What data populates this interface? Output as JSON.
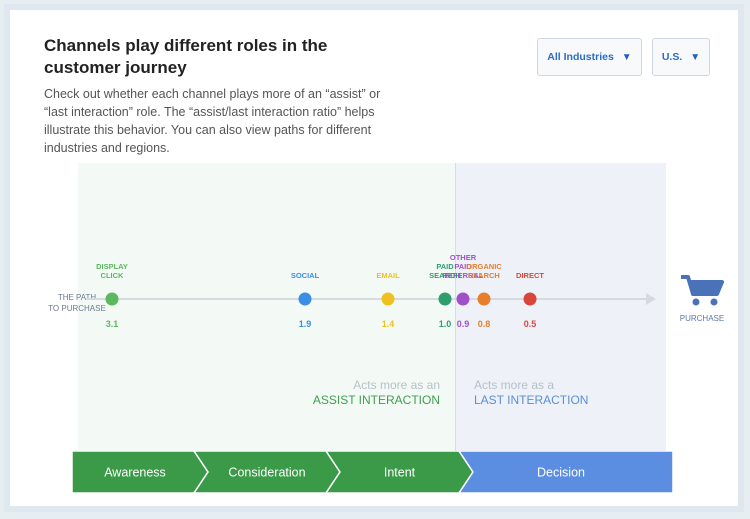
{
  "header": {
    "title": "Channels play different roles in the customer journey",
    "description": "Check out whether each channel plays more of an “assist” or “last interaction” role. The “assist/last interaction ratio” helps illustrate this behavior. You can also view paths for different industries and regions."
  },
  "filters": {
    "industry": "All Industries",
    "region": "U.S."
  },
  "path": {
    "label_line1": "THE PATH",
    "label_line2": "TO PURCHASE",
    "end_label": "PURCHASE"
  },
  "channels": [
    {
      "name_lines": [
        "DISPLAY",
        "CLICK"
      ],
      "ratio": "3.1",
      "color": "#5cb85c"
    },
    {
      "name_lines": [
        "SOCIAL"
      ],
      "ratio": "1.9",
      "color": "#3a8ee6"
    },
    {
      "name_lines": [
        "EMAIL"
      ],
      "ratio": "1.4",
      "color": "#f0c020"
    },
    {
      "name_lines": [
        "PAID",
        "SEARCH"
      ],
      "ratio": "1.0",
      "color": "#2e9e6e"
    },
    {
      "name_lines": [
        "OTHER",
        "PAID",
        "REFERRAL"
      ],
      "ratio": "0.9",
      "color": "#a050c8"
    },
    {
      "name_lines": [
        "ORGANIC",
        "SEARCH"
      ],
      "ratio": "0.8",
      "color": "#e87d2a"
    },
    {
      "name_lines": [
        "DIRECT"
      ],
      "ratio": "0.5",
      "color": "#d9453a"
    }
  ],
  "roles": {
    "assist": {
      "line1": "Acts more as an",
      "line2": "ASSIST INTERACTION"
    },
    "last": {
      "line1": "Acts more as a",
      "line2": "LAST INTERACTION"
    }
  },
  "stages": [
    {
      "label": "Awareness",
      "color": "#3a9a47"
    },
    {
      "label": "Consideration",
      "color": "#3a9a47"
    },
    {
      "label": "Intent",
      "color": "#3a9a47"
    },
    {
      "label": "Decision",
      "color": "#5b8ee0"
    }
  ],
  "colors": {
    "axis": "#d5dae0",
    "cart": "#4a72b8"
  }
}
